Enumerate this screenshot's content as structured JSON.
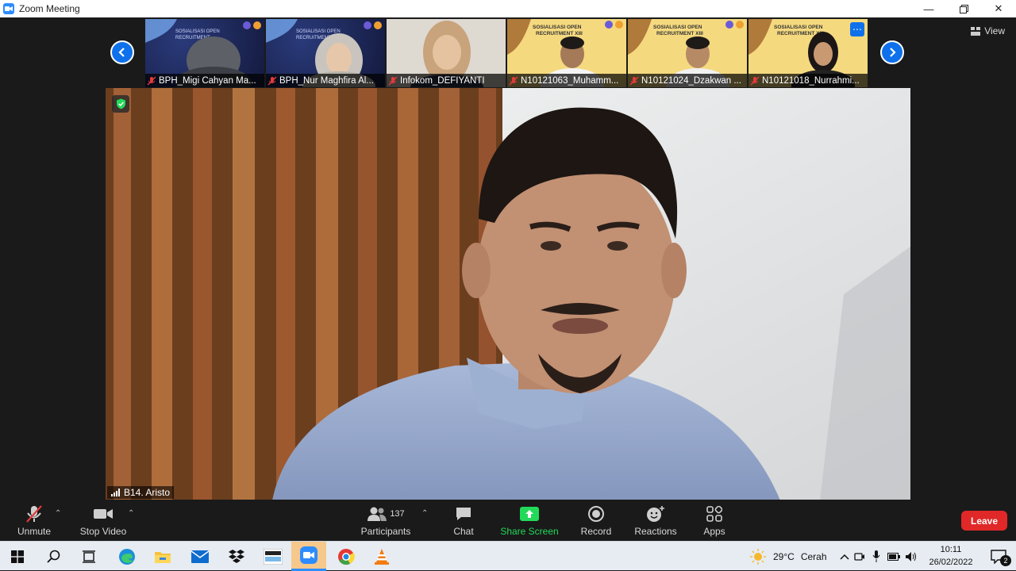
{
  "window": {
    "title": "Zoom Meeting",
    "controls": [
      "minimize-icon",
      "restore-icon",
      "close-icon"
    ]
  },
  "gallery": {
    "view_label": "View",
    "participants": [
      {
        "name": "BPH_Migi Cahyan Ma...",
        "muted": true
      },
      {
        "name": "BPH_Nur Maghfira Al...",
        "muted": true
      },
      {
        "name": "Infokom_DEFIYANTI",
        "muted": true
      },
      {
        "name": "N10121063_Muhamm...",
        "muted": true
      },
      {
        "name": "N10121024_Dzakwan ...",
        "muted": true
      },
      {
        "name": "N10121018_Nurrahmi...",
        "muted": true
      }
    ],
    "banner_text": "SOSIALISASI OPEN RECRUITMENT XIII"
  },
  "active_speaker": {
    "name": "B14. Aristo"
  },
  "toolbar": {
    "unmute": "Unmute",
    "stop_video": "Stop Video",
    "participants": "Participants",
    "participants_count": "137",
    "chat": "Chat",
    "share_screen": "Share Screen",
    "record": "Record",
    "reactions": "Reactions",
    "apps": "Apps",
    "leave": "Leave"
  },
  "taskbar": {
    "weather_temp": "29°C",
    "weather_desc": "Cerah",
    "time": "10:11",
    "date": "26/02/2022",
    "notification_count": "2"
  },
  "colors": {
    "accent_blue": "#0e71eb",
    "share_green": "#23d959",
    "leave_red": "#e02828",
    "bg_dark": "#1a1a1a"
  }
}
